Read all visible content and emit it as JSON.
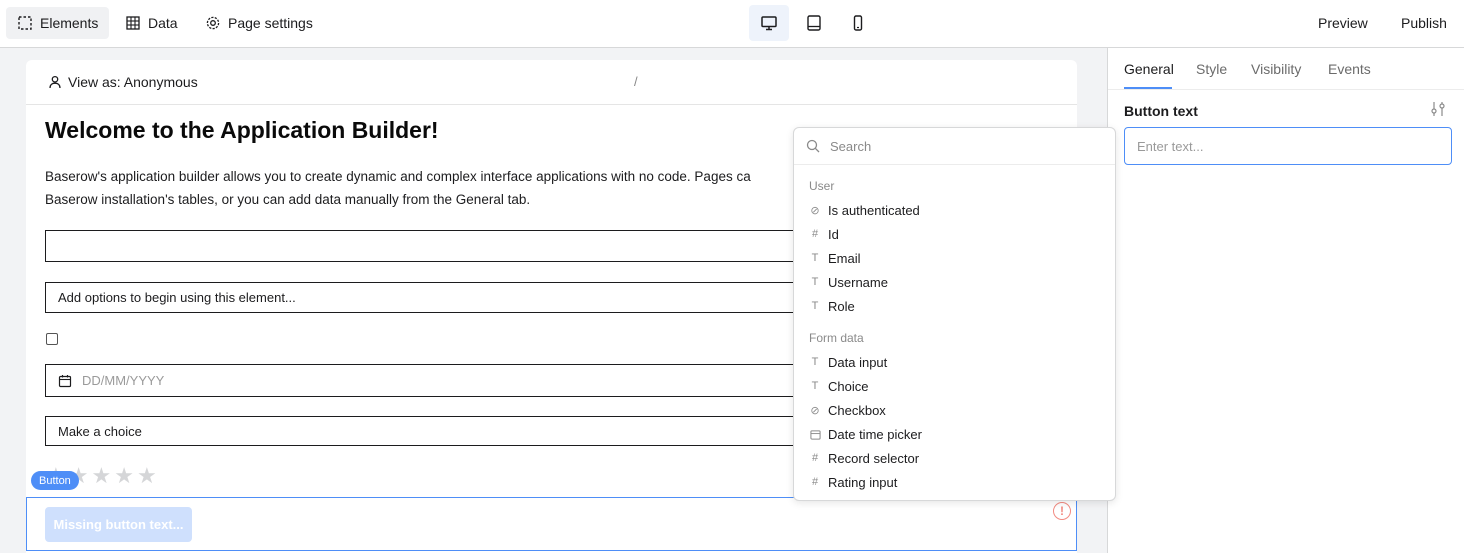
{
  "topbar": {
    "elements_label": "Elements",
    "data_label": "Data",
    "page_settings_label": "Page settings",
    "preview_label": "Preview",
    "publish_label": "Publish"
  },
  "canvas": {
    "view_as": "View as: Anonymous",
    "path_slash": "/",
    "heading": "Welcome to the Application Builder!",
    "paragraph_line1": "Baserow's application builder allows you to create dynamic and complex interface applications with no code. Pages ca",
    "paragraph_line2": "Baserow installation's tables, or you can add data manually from the General tab.",
    "choice_placeholder": "Add options to begin using this element...",
    "date_placeholder": "DD/MM/YYYY",
    "select_placeholder": "Make a choice",
    "rating_value": 0,
    "rating_max": 5,
    "button_tag": "Button",
    "missing_button_text": "Missing button text..."
  },
  "panel": {
    "tabs": [
      {
        "label": "General"
      },
      {
        "label": "Style"
      },
      {
        "label": "Visibility"
      },
      {
        "label": "Events"
      }
    ],
    "active_tab": "General",
    "button_text_label": "Button text",
    "button_text_placeholder": "Enter text..."
  },
  "dropdown": {
    "search_placeholder": "Search",
    "groups": [
      {
        "label": "User",
        "items": [
          {
            "label": "Is authenticated",
            "icon": "check-circle-icon"
          },
          {
            "label": "Id",
            "icon": "hash-icon"
          },
          {
            "label": "Email",
            "icon": "text-icon"
          },
          {
            "label": "Username",
            "icon": "text-icon"
          },
          {
            "label": "Role",
            "icon": "text-icon"
          }
        ]
      },
      {
        "label": "Form data",
        "items": [
          {
            "label": "Data input",
            "icon": "text-icon"
          },
          {
            "label": "Choice",
            "icon": "text-icon"
          },
          {
            "label": "Checkbox",
            "icon": "check-circle-icon"
          },
          {
            "label": "Date time picker",
            "icon": "calendar-icon"
          },
          {
            "label": "Record selector",
            "icon": "hash-icon"
          },
          {
            "label": "Rating input",
            "icon": "hash-icon"
          }
        ]
      }
    ]
  },
  "colors": {
    "accent": "#4e8ef7",
    "button_disabled": "#cfe0fd",
    "warning": "#f28b82"
  }
}
